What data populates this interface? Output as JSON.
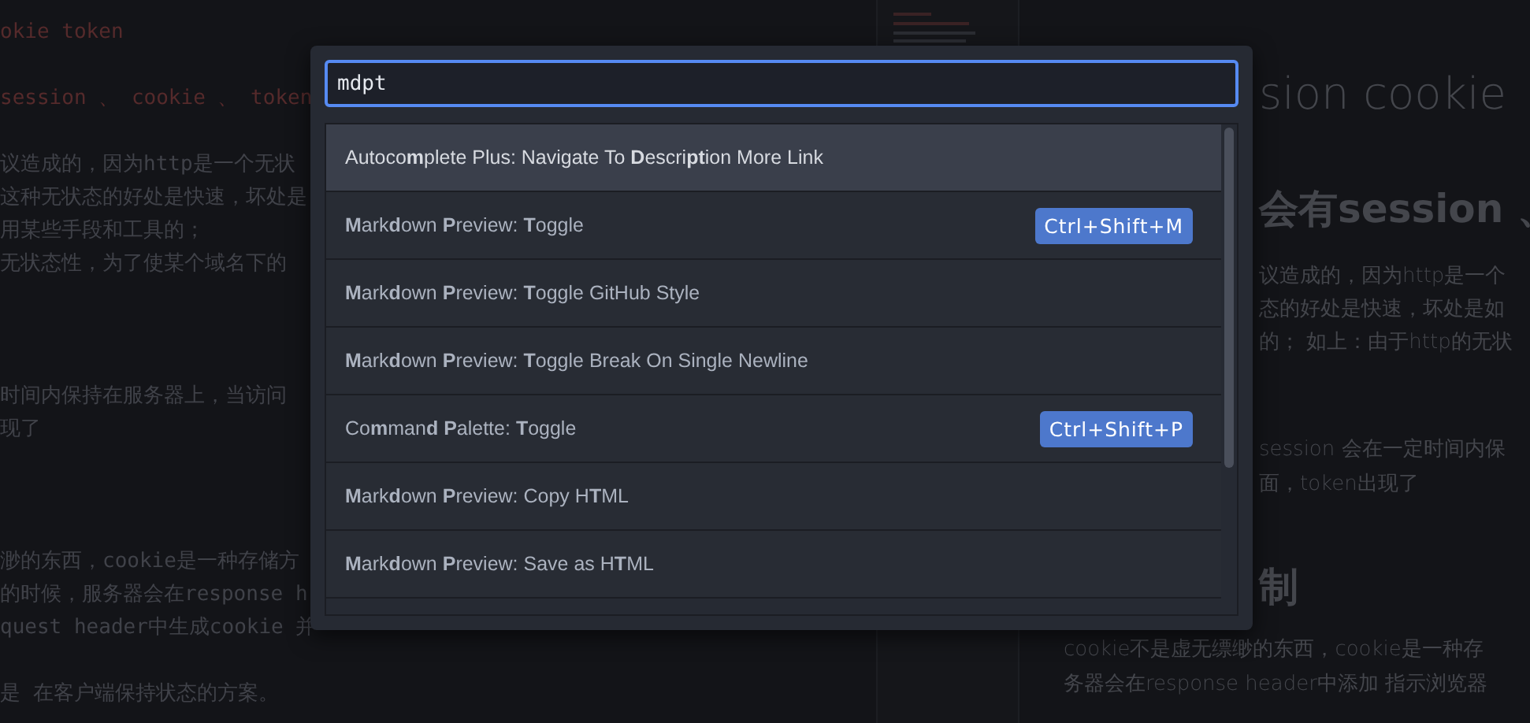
{
  "editor": {
    "lines": [
      {
        "text": "okie token",
        "kind": "heading"
      },
      {
        "text": "session 、 cookie 、 token",
        "kind": "heading"
      },
      {
        "text": "议造成的，因为http是一个无状",
        "kind": "text"
      },
      {
        "text": "这种无状态的好处是快速，坏处是",
        "kind": "text"
      },
      {
        "text": "用某些手段和工具的；",
        "kind": "text"
      },
      {
        "text": "无状态性，为了使某个域名下的",
        "kind": "text"
      },
      {
        "text": "时间内保持在服务器上，当访问",
        "kind": "text"
      },
      {
        "text": "现了",
        "kind": "text"
      },
      {
        "text": "渺的东西，cookie是一种存储方",
        "kind": "text"
      },
      {
        "text": "的时候，服务器会在response h",
        "kind": "text"
      },
      {
        "text": "quest header中生成cookie 并",
        "kind": "text"
      },
      {
        "text": "是 在客户端保持状态的方案。",
        "kind": "text"
      }
    ]
  },
  "preview": {
    "lines": [
      {
        "text": "sion cookie",
        "kind": "title"
      },
      {
        "text": "会有session 、",
        "kind": "heading"
      },
      {
        "text": "议造成的，因为http是一个",
        "kind": "text"
      },
      {
        "text": "态的好处是快速，坏处是如",
        "kind": "text"
      },
      {
        "text": "的； 如上：由于http的无状",
        "kind": "text"
      },
      {
        "text": "session 会在一定时间内保",
        "kind": "text"
      },
      {
        "text": "面，token出现了",
        "kind": "text"
      },
      {
        "text": "制",
        "kind": "heading"
      },
      {
        "text": "cookie不是虚无缥缈的东西，cookie是一种存",
        "kind": "text"
      },
      {
        "text": "务器会在response header中添加 指示浏览器",
        "kind": "text"
      }
    ]
  },
  "command_palette": {
    "query": "mdpt",
    "items": [
      {
        "label": "Autoco**m**plete Plus: Navigate To **D**escri**pt**ion More Link",
        "selected": true
      },
      {
        "label": "**M**ark**d**own **P**review: **T**oggle",
        "keybinding": "Ctrl+Shift+M",
        "selected": false
      },
      {
        "label": "**M**ark**d**own **P**review: **T**oggle GitHub Style",
        "selected": false
      },
      {
        "label": "**M**ark**d**own **P**review: **T**oggle Break On Single Newline",
        "selected": false
      },
      {
        "label": "Co**m**man**d** **P**alette: **T**oggle",
        "keybinding": "Ctrl+Shift+P",
        "selected": false
      },
      {
        "label": "**M**ark**d**own **P**review: Copy H**T**ML",
        "selected": false
      },
      {
        "label": "**M**ark**d**own **P**review: Save as H**T**ML",
        "selected": false
      }
    ]
  }
}
